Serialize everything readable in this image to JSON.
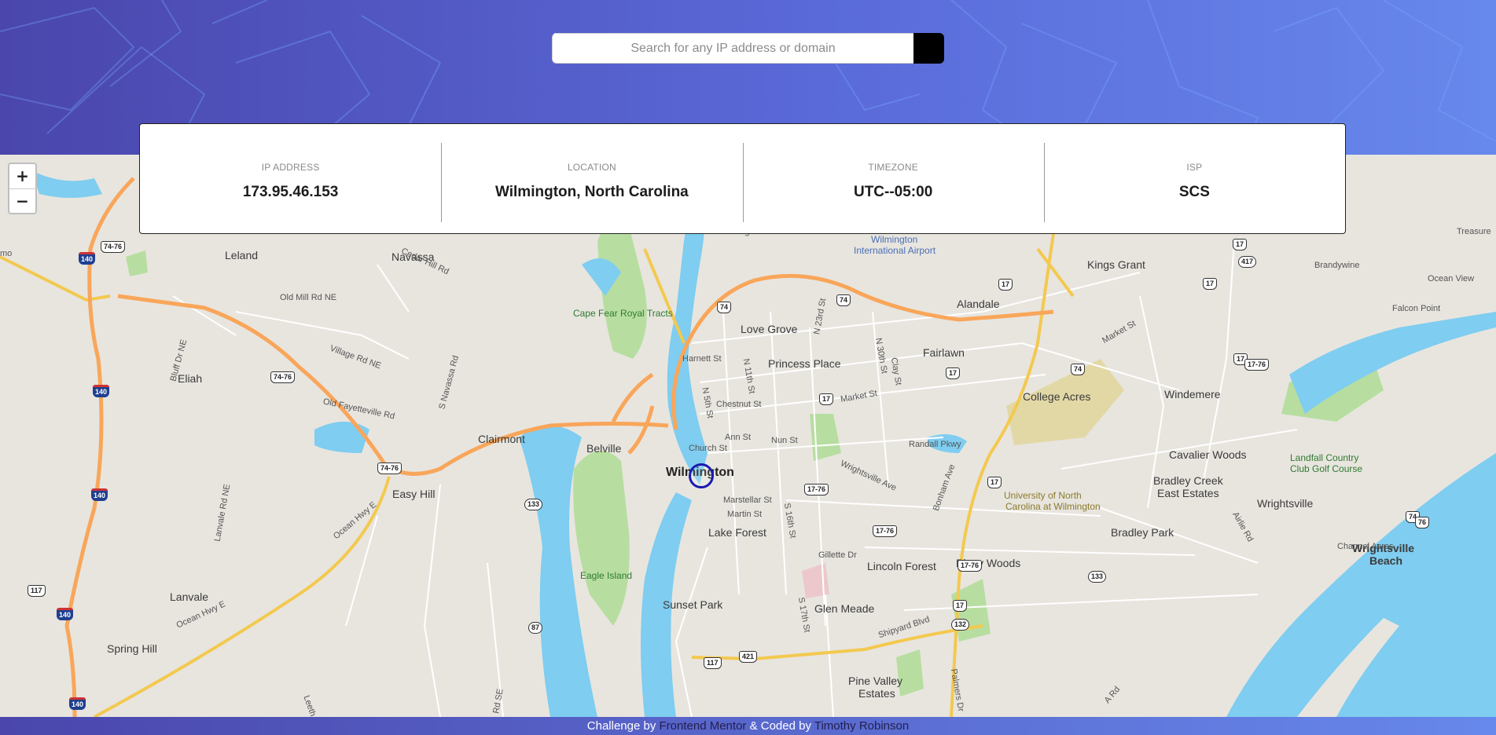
{
  "search": {
    "placeholder": "Search for any IP address or domain",
    "button_icon": "chevron-right-icon"
  },
  "info": {
    "ip": {
      "label": "IP ADDRESS",
      "value": "173.95.46.153"
    },
    "location": {
      "label": "LOCATION",
      "value": "Wilmington, North Carolina"
    },
    "timezone": {
      "label": "TIMEZONE",
      "value": "UTC--05:00"
    },
    "isp": {
      "label": "ISP",
      "value": "SCS"
    }
  },
  "map": {
    "zoom_in": "+",
    "zoom_out": "−",
    "labels": {
      "wilmington": "Wilmington",
      "leland": "Leland",
      "navassa": "Navassa",
      "belville": "Belville",
      "clairmont": "Clairmont",
      "eliah": "Eliah",
      "easy_hill": "Easy Hill",
      "lanvale": "Lanvale",
      "spring_hill": "Spring Hill",
      "love_grove": "Love Grove",
      "princess_place": "Princess Place",
      "lake_forest": "Lake Forest",
      "sunset_park": "Sunset Park",
      "glen_meade": "Glen Meade",
      "pine_valley": "Pine Valley",
      "estates": "Estates",
      "lincoln_forest": "Lincoln Forest",
      "piney_woods": "Piney Woods",
      "fairlawn": "Fairlawn",
      "alandale": "Alandale",
      "kings_grant": "Kings Grant",
      "college_acres": "College Acres",
      "windemere": "Windemere",
      "cavalier_woods": "Cavalier Woods",
      "bradley_creek": "Bradley Creek",
      "east_estates": "East Estates",
      "bradley_park": "Bradley Park",
      "wrightsville": "Wrightsville",
      "wrightsville_beach_1": "Wrightsville",
      "wrightsville_beach_2": "Beach",
      "channel_acres": "Channel Acres",
      "brandywine": "Brandywine",
      "ocean_view": "Ocean View",
      "falcon_point": "Falcon Point",
      "treasure": "Treasure",
      "cape_fear": "Cape Fear Royal Tracts",
      "eagle_island": "Eagle Island",
      "unc_1": "University of North",
      "unc_2": "Carolina at Wilmington",
      "landfall_1": "Landfall Country",
      "landfall_2": "Club Golf Course",
      "airport_1": "Wilmington",
      "airport_2": "International Airport",
      "highsmith": "Highsmith",
      "mo": "mo",
      "cedar_hill": "Cedar Hill Rd",
      "old_mill": "Old Mill Rd NE",
      "village_rd": "Village Rd NE",
      "old_fayetteville": "Old Fayetteville Rd",
      "ocean_hwy": "Ocean Hwy E",
      "ocean_hwy2": "Ocean Hwy E",
      "harnett": "Harnett St",
      "chestnut": "Chestnut St",
      "market": "Market St",
      "market2": "Market St",
      "church": "Church St",
      "ann": "Ann St",
      "nun": "Nun St",
      "marstellar": "Marstellar St",
      "martin": "Martin St",
      "randall": "Randall Pkwy",
      "wrightsville_ave": "Wrightsville Ave",
      "shipyard": "Shipyard Blvd",
      "gillette": "Gillette Dr",
      "s16th": "S 16th St",
      "s17th": "S 17th St",
      "n23rd": "N 23rd St",
      "n30th": "N 30th St",
      "n11th": "N 11th St",
      "n5th": "N 5th St",
      "clay": "Clay St",
      "bonham": "Bonham Ave",
      "airlie": "Airlie Rd",
      "lanvale_rd": "Lanvale Rd NE",
      "bluff": "Bluff Dr NE",
      "snavassa": "S Navassa Rd",
      "a_rd": "A Rd",
      "palmers": "Palmers Dr",
      "rd_se": "Rd SE",
      "leeth": "Leeth"
    },
    "shields": [
      "140",
      "140",
      "140",
      "140",
      "140",
      "74-76",
      "74-76",
      "74-76",
      "74",
      "74",
      "74",
      "74",
      "17",
      "17",
      "17",
      "17",
      "17",
      "17",
      "17",
      "17",
      "17-76",
      "17-76",
      "17-76",
      "17-76",
      "133",
      "133",
      "87",
      "117",
      "117",
      "421",
      "132",
      "417",
      "76"
    ]
  },
  "footer": {
    "prefix": "Challenge by ",
    "link1": "Frontend Mentor",
    "middle": " & Coded by ",
    "link2": "Timothy Robinson"
  },
  "colors": {
    "header_start": "#4a46ac",
    "header_end": "#6788ec",
    "water": "#7fcdf0",
    "park": "#b7dea0",
    "highway": "#f9a65a",
    "marker": "#1a1ab4"
  }
}
